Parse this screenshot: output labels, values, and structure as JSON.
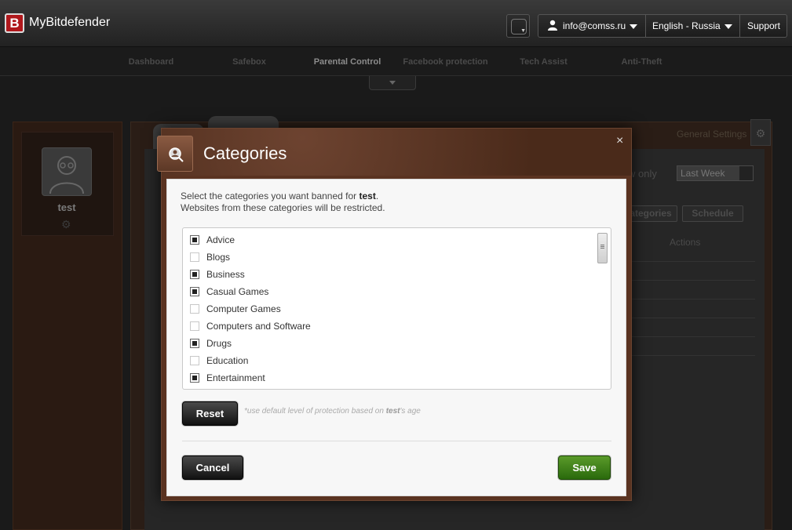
{
  "header": {
    "logo_letter": "B",
    "brand": "MyBitdefender",
    "account": "info@comss.ru",
    "language": "English - Russia",
    "support": "Support"
  },
  "nav": {
    "items": [
      {
        "label": "Dashboard"
      },
      {
        "label": "Safebox"
      },
      {
        "label": "Parental Control",
        "active": true
      },
      {
        "label": "Facebook protection"
      },
      {
        "label": "Tech Assist"
      },
      {
        "label": "Anti-Theft"
      }
    ]
  },
  "background": {
    "profile_name": "test",
    "general_settings": "General Settings",
    "show_only": "w only",
    "period": "Last Week",
    "categories_btn": "ategories",
    "schedule_btn": "Schedule",
    "actions_col": "Actions"
  },
  "modal": {
    "title": "Categories",
    "close": "×",
    "intro_line1_prefix": "Select the categories you want banned for ",
    "intro_user": "test",
    "intro_line1_suffix": ".",
    "intro_line2": "Websites from these categories will be restricted.",
    "categories": [
      {
        "label": "Advice",
        "checked": true
      },
      {
        "label": "Blogs",
        "checked": false
      },
      {
        "label": "Business",
        "checked": true
      },
      {
        "label": "Casual Games",
        "checked": true
      },
      {
        "label": "Computer Games",
        "checked": false
      },
      {
        "label": "Computers and Software",
        "checked": false
      },
      {
        "label": "Drugs",
        "checked": true
      },
      {
        "label": "Education",
        "checked": false
      },
      {
        "label": "Entertainment",
        "checked": true
      }
    ],
    "reset": "Reset",
    "note_prefix": "*use default level of protection based on ",
    "note_user": "test",
    "note_suffix": "'s age",
    "cancel": "Cancel",
    "save": "Save"
  }
}
